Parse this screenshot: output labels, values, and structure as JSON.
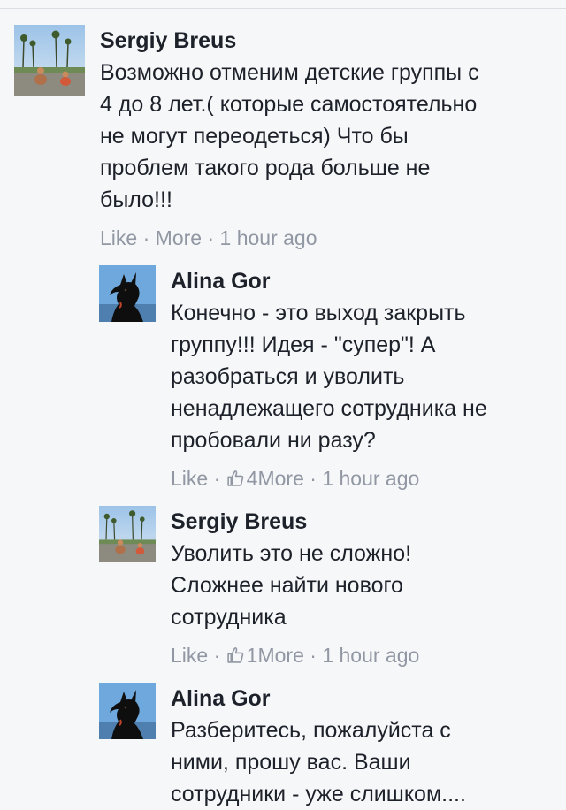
{
  "comments": [
    {
      "author": "Sergiy Breus",
      "text": "Возможно отменим детские группы с\n4 до 8 лет.( которые самостоятельно\nне могут переодеться) Что бы\nпроблем такого рода больше не\nбыло!!!",
      "like": "Like",
      "more": "More",
      "time": "1 hour ago",
      "sep": "·",
      "avatar_icon": "beach-photo-avatar"
    },
    {
      "author": "Alina Gor",
      "text": "Конечно - это выход закрыть\nгруппу!!! Идея - \"супер\"! А\nразобраться и уволить\nненадлежащего сотрудника не\nпробовали ни разу?",
      "like": "Like",
      "reactions": "4",
      "more": "More",
      "time": "1 hour ago",
      "sep": "·",
      "avatar_icon": "black-dog-avatar"
    },
    {
      "author": "Sergiy Breus",
      "text": "Уволить это не сложно!\nСложнее найти нового\nсотрудника",
      "like": "Like",
      "reactions": "1",
      "more": "More",
      "time": "1 hour ago",
      "sep": "·",
      "avatar_icon": "beach-photo-avatar"
    },
    {
      "author": "Alina Gor",
      "text": "Разберитесь, пожалуйста с\nними, прошу вас. Ваши\nсотрудники - уже слишком....",
      "avatar_icon": "black-dog-avatar"
    }
  ],
  "colors": {
    "background": "#f6f7f9",
    "text": "#1d2129",
    "meta": "#9197a3"
  }
}
